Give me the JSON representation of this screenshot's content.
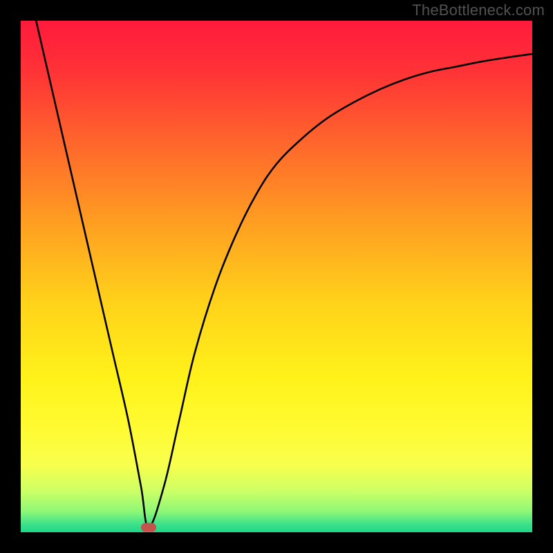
{
  "watermark": "TheBottleneck.com",
  "chart_data": {
    "type": "line",
    "title": "",
    "xlabel": "",
    "ylabel": "",
    "xlim": [
      0,
      100
    ],
    "ylim": [
      0,
      100
    ],
    "x": [
      3,
      6,
      9,
      12,
      15,
      18,
      21,
      23.5,
      25,
      28,
      31,
      34,
      38,
      42,
      46,
      50,
      55,
      60,
      65,
      70,
      75,
      80,
      85,
      90,
      95,
      100
    ],
    "y": [
      100,
      87,
      74,
      61,
      48,
      35,
      22,
      9,
      1,
      9,
      22,
      35,
      48,
      58,
      66,
      72,
      77,
      81,
      84,
      86.5,
      88.5,
      90,
      91,
      92,
      92.8,
      93.5
    ],
    "minimum_point": {
      "x": 25,
      "y": 1
    },
    "gradient_stops": [
      {
        "pos": 0.0,
        "color": "#ff1a3c"
      },
      {
        "pos": 0.1,
        "color": "#ff3336"
      },
      {
        "pos": 0.25,
        "color": "#ff6a2b"
      },
      {
        "pos": 0.4,
        "color": "#ffa021"
      },
      {
        "pos": 0.55,
        "color": "#ffd21a"
      },
      {
        "pos": 0.7,
        "color": "#fff21a"
      },
      {
        "pos": 0.8,
        "color": "#fffb33"
      },
      {
        "pos": 0.87,
        "color": "#f7ff4d"
      },
      {
        "pos": 0.92,
        "color": "#ccff66"
      },
      {
        "pos": 0.96,
        "color": "#8cf777"
      },
      {
        "pos": 0.985,
        "color": "#3be08c"
      },
      {
        "pos": 1.0,
        "color": "#1dd884"
      }
    ],
    "marker_color": "#c4534e"
  }
}
